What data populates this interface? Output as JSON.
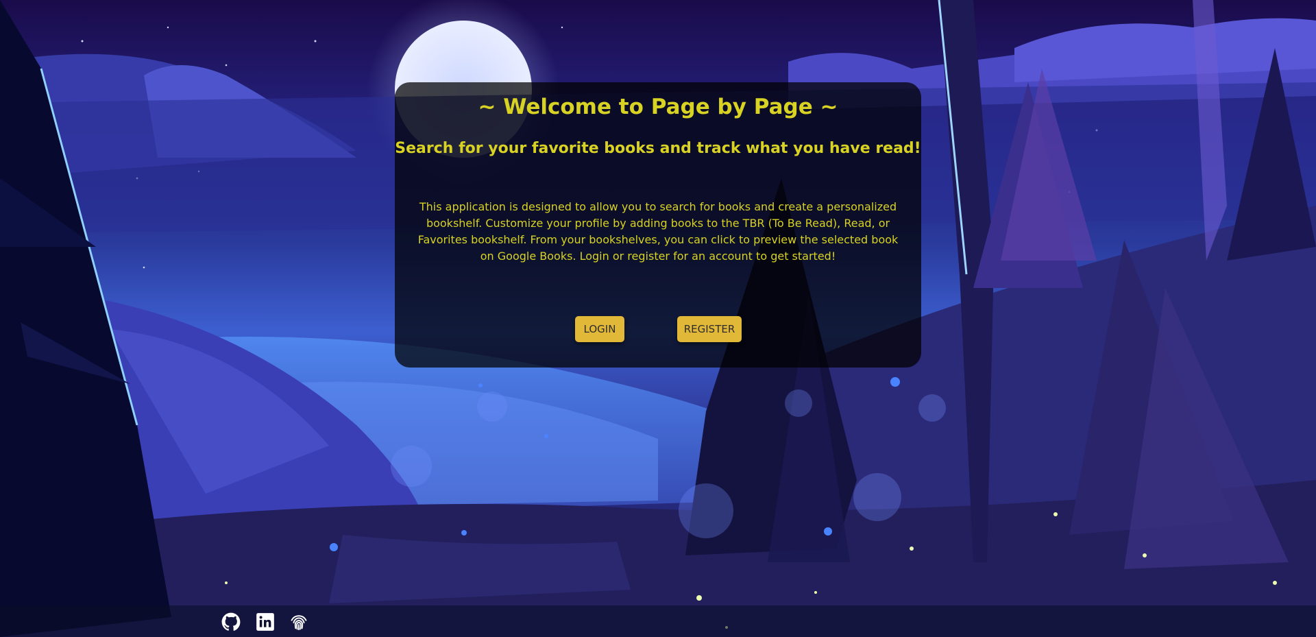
{
  "welcome": {
    "title": "~ Welcome to Page by Page ~",
    "subtitle": "Search for your favorite books and track what you have read!",
    "description": "This application is designed to allow you to search for books and create a personalized bookshelf. Customize your profile by adding books to the TBR (To Be Read), Read, or Favorites bookshelf. From your bookshelves, you can click to preview the selected book on Google Books. Login or register for an account to get started!",
    "login_label": "LOGIN",
    "register_label": "REGISTER"
  },
  "footer": {
    "icons": [
      "github-icon",
      "linkedin-icon",
      "fingerprint-icon"
    ]
  },
  "colors": {
    "text_accent": "#d8d224",
    "button_bg": "#e2b838",
    "card_bg": "rgba(0,0,0,0.72)"
  }
}
